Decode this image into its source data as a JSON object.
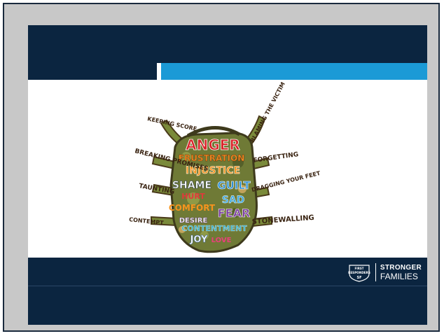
{
  "illustration": {
    "core_emotions": [
      "ANGER",
      "FRUSTRATION",
      "INJUSTICE",
      "SHAME",
      "GUILT",
      "HURT",
      "SAD",
      "COMFORT",
      "FEAR",
      "DESIRE",
      "CONTENTMENT",
      "JOY",
      "LOVE"
    ],
    "behaviors": [
      "KEEPING SCORE",
      "BLAMING THE VICTIM",
      "BREAKING PROMISES",
      "FORGETTING",
      "TAUNTING",
      "DRAGGING YOUR FEET",
      "CONTEMPT",
      "STONEWALLING"
    ]
  },
  "footer": {
    "badge": {
      "top": "FIRST",
      "middle": "RESPONDERS",
      "bottom": "SF"
    },
    "brand": {
      "line1": "STRONGER",
      "line2": "FAMILIES"
    }
  }
}
